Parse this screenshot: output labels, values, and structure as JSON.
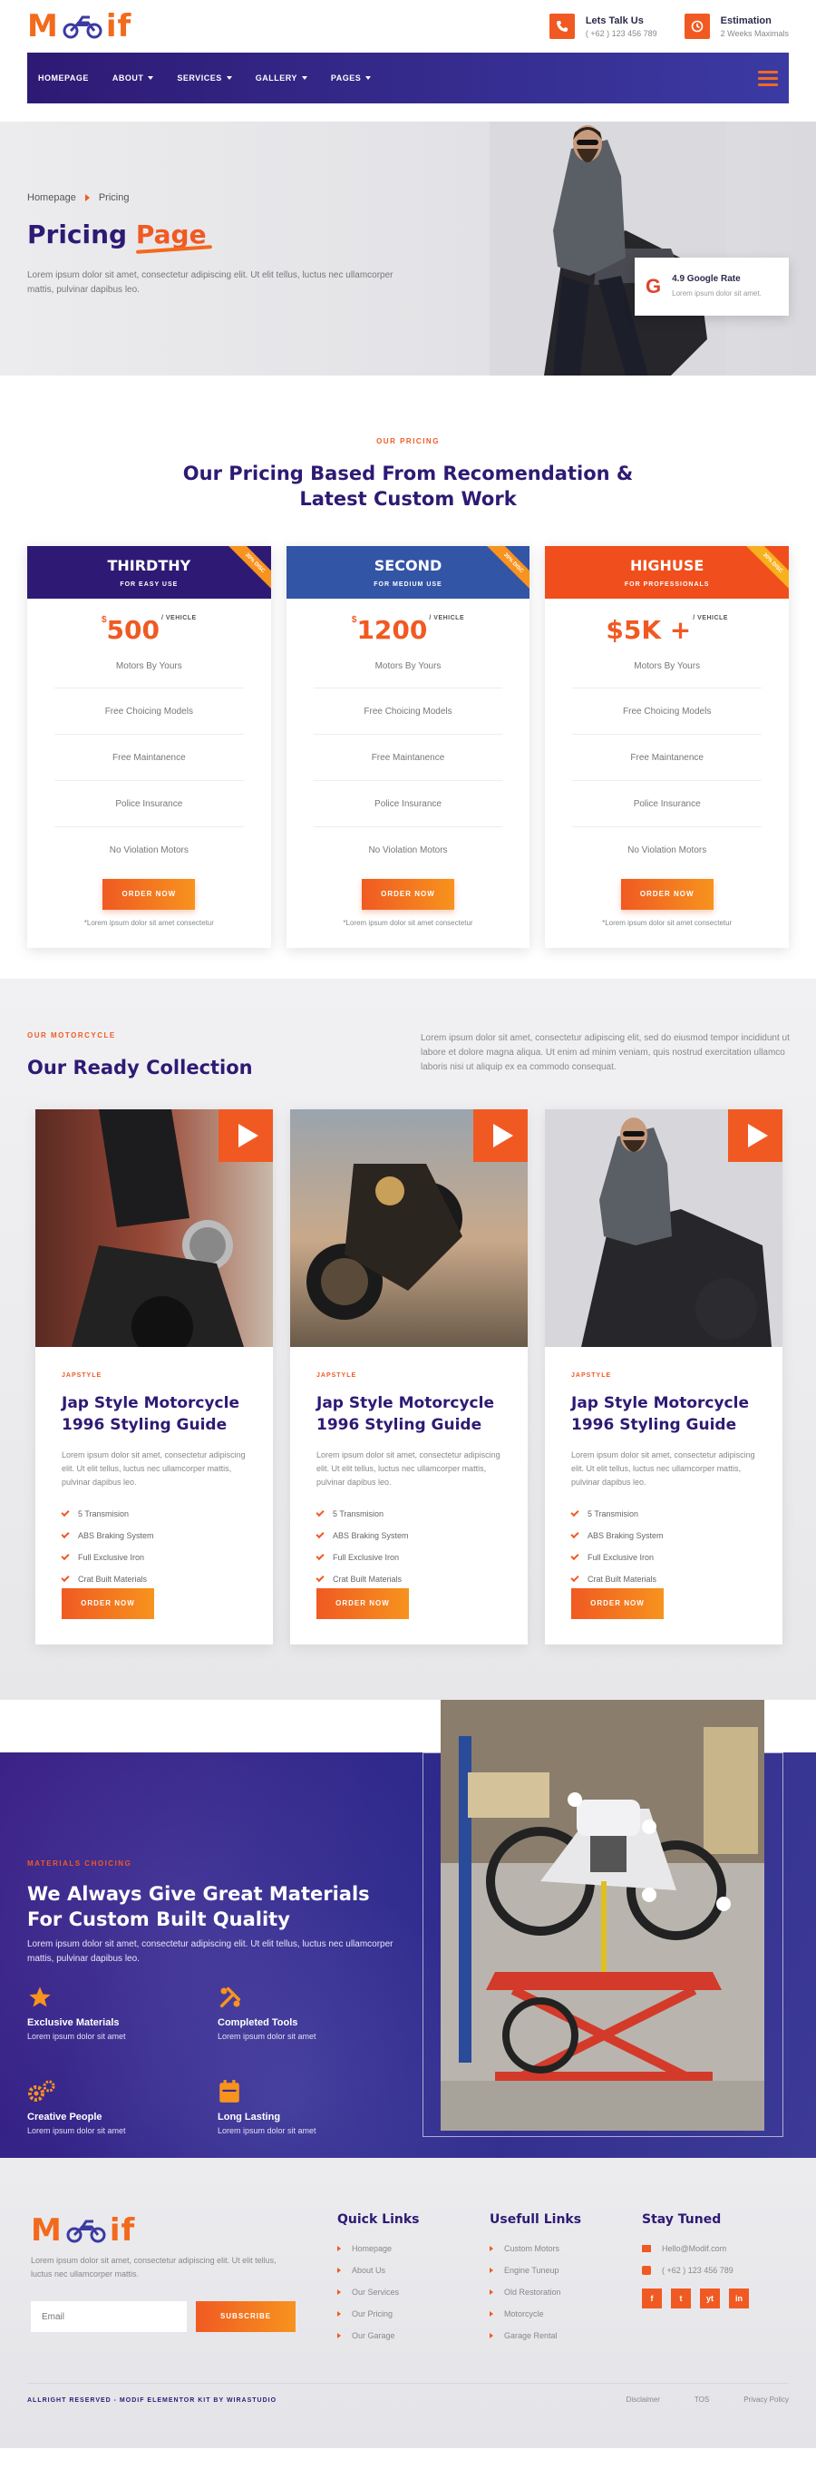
{
  "header": {
    "logo_left": "M",
    "logo_right": "if",
    "contacts": [
      {
        "icon": "phone-icon",
        "title": "Lets Talk Us",
        "sub": "( +62 ) 123 456 789"
      },
      {
        "icon": "clock-icon",
        "title": "Estimation",
        "sub": "2 Weeks Maximals"
      }
    ]
  },
  "nav": {
    "items": [
      {
        "label": "HOMEPAGE",
        "dropdown": false
      },
      {
        "label": "ABOUT",
        "dropdown": true
      },
      {
        "label": "SERVICES",
        "dropdown": true
      },
      {
        "label": "GALLERY",
        "dropdown": true
      },
      {
        "label": "PAGES",
        "dropdown": true
      }
    ]
  },
  "hero": {
    "breadcrumb_home": "Homepage",
    "breadcrumb_current": "Pricing",
    "title_main": "Pricing",
    "title_accent": "Page",
    "text": "Lorem ipsum dolor sit amet, consectetur adipiscing elit. Ut elit tellus, luctus nec ullamcorper mattis, pulvinar dapibus leo.",
    "rating_title": "4.9 Google Rate",
    "rating_sub": "Lorem ipsum dolor sit amet."
  },
  "pricing": {
    "kicker": "OUR PRICING",
    "title_line1": "Our Pricing Based From Recomendation &",
    "title_line2": "Latest Custom Work",
    "plans": [
      {
        "name": "THIRDTHY",
        "sub": "FOR EASY USE",
        "ribbon": "30% DISC",
        "currency": "$",
        "amount": "500",
        "per": "/ VEHICLE",
        "color": "#2e1a74"
      },
      {
        "name": "SECOND",
        "sub": "FOR MEDIUM USE",
        "ribbon": "30% DISC",
        "currency": "$",
        "amount": "1200",
        "per": "/ VEHICLE",
        "color": "#3355a6"
      },
      {
        "name": "HIGHUSE",
        "sub": "FOR PROFESSIONALS",
        "ribbon": "30% DISC",
        "currency": "",
        "amount": "$5K +",
        "per": "/ VEHICLE",
        "color": "#f04e1c"
      }
    ],
    "features": [
      "Motors By Yours",
      "Free Choicing Models",
      "Free Maintanence",
      "Police Insurance",
      "No Violation Motors"
    ],
    "button": "ORDER NOW",
    "note": "*Lorem ipsum dolor sit amet consectetur"
  },
  "collection": {
    "kicker": "OUR MOTORCYCLE",
    "title": "Our Ready Collection",
    "intro": "Lorem ipsum dolor sit amet, consectetur adipiscing elit, sed do eiusmod tempor incididunt ut labore et dolore magna aliqua. Ut enim ad minim veniam, quis nostrud exercitation ullamco laboris nisi ut aliquip ex ea commodo consequat.",
    "card": {
      "tag": "JAPSTYLE",
      "title": "Jap Style Motorcycle 1996 Styling Guide",
      "desc": "Lorem ipsum dolor sit amet, consectetur adipiscing elit. Ut elit tellus, luctus nec ullamcorper mattis, pulvinar dapibus leo.",
      "features": [
        "5 Transmision",
        "ABS Braking System",
        "Full Exclusive Iron",
        "Crat Built Materials"
      ],
      "button": "ORDER NOW"
    }
  },
  "materials": {
    "kicker": "MATERIALS CHOICING",
    "title": "We Always Give Great Materials For Custom Built Quality",
    "text": "Lorem ipsum dolor sit amet, consectetur adipiscing elit. Ut elit tellus, luctus nec ullamcorper mattis, pulvinar dapibus leo.",
    "items": [
      {
        "icon": "star-icon",
        "title": "Exclusive Materials",
        "sub": "Lorem ipsum dolor sit amet"
      },
      {
        "icon": "tools-icon",
        "title": "Completed Tools",
        "sub": "Lorem ipsum dolor sit amet"
      },
      {
        "icon": "gears-icon",
        "title": "Creative People",
        "sub": "Lorem ipsum dolor sit amet"
      },
      {
        "icon": "calendar-icon",
        "title": "Long Lasting",
        "sub": "Lorem ipsum dolor sit amet"
      }
    ]
  },
  "footer": {
    "text": "Lorem ipsum dolor sit amet, consectetur adipiscing elit. Ut elit tellus, luctus nec ullamcorper mattis.",
    "email_placeholder": "Email",
    "subscribe": "SUBSCRIBE",
    "quick_links_title": "Quick Links",
    "quick_links": [
      "Homepage",
      "About Us",
      "Our Services",
      "Our Pricing",
      "Our Garage"
    ],
    "useful_links_title": "Usefull Links",
    "useful_links": [
      "Custom Motors",
      "Engine Tuneup",
      "Old Restoration",
      "Motorcycle",
      "Garage Rental"
    ],
    "stay_title": "Stay Tuned",
    "email": "Hello@Modif.com",
    "phone": "( +62 ) 123 456 789",
    "social": [
      "f",
      "t",
      "yt",
      "in"
    ],
    "copyright": "ALLRIGHT RESERVED - MODIF ELEMENTOR KIT BY WIRASTUDIO",
    "legal": [
      "Disclaimer",
      "TOS",
      "Privacy Policy"
    ]
  },
  "colors": {
    "primary": "#2e1a74",
    "accent": "#f05a22"
  }
}
